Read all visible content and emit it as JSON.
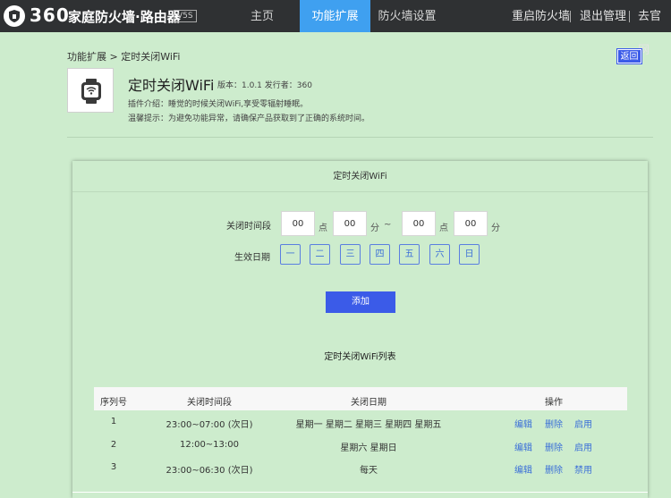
{
  "topbar": {
    "logo_number": "360",
    "logo_title": "家庭防火墙·路由器",
    "logo_version": "V5S",
    "nav": [
      {
        "label": "主页"
      },
      {
        "label": "功能扩展"
      },
      {
        "label": "防火墙设置"
      }
    ],
    "right_links": [
      {
        "label": "重启防火墙"
      },
      {
        "label": "退出管理"
      },
      {
        "label": "去官网"
      }
    ]
  },
  "header": {
    "breadcrumb": "功能扩展 > 定时关闭WiFi",
    "back_label": "返回",
    "app_name": "定时关闭WiFi",
    "app_meta": "版本：1.0.1      发行者：360",
    "app_desc": "插件介绍：睡觉的时候关闭WiFi,享受零辐射睡眠。",
    "app_tip": "温馨提示：为避免功能异常，请确保产品获取到了正确的系统时间。"
  },
  "panel": {
    "title": "定时关闭WiFi",
    "time_label": "关闭时间段",
    "start_hour": "00",
    "start_min": "00",
    "end_hour": "00",
    "end_min": "00",
    "unit_hour": "点",
    "unit_min": "分",
    "tilde": "~",
    "date_label": "生效日期",
    "days": [
      "一",
      "二",
      "三",
      "四",
      "五",
      "六",
      "日"
    ],
    "add_label": "添加",
    "list_title": "定时关闭WiFi列表",
    "columns": [
      "序列号",
      "关闭时间段",
      "关闭日期",
      "操作"
    ],
    "rows": [
      {
        "no": "1",
        "time": "23:00~07:00 (次日)",
        "days": "星期一 星期二 星期三 星期四 星期五",
        "edit": "编辑",
        "del": "删除",
        "toggle": "启用"
      },
      {
        "no": "2",
        "time": "12:00~13:00",
        "days": "星期六 星期日",
        "edit": "编辑",
        "del": "删除",
        "toggle": "启用"
      },
      {
        "no": "3",
        "time": "23:00~06:30 (次日)",
        "days": "每天",
        "edit": "编辑",
        "del": "删除",
        "toggle": "禁用"
      }
    ]
  }
}
